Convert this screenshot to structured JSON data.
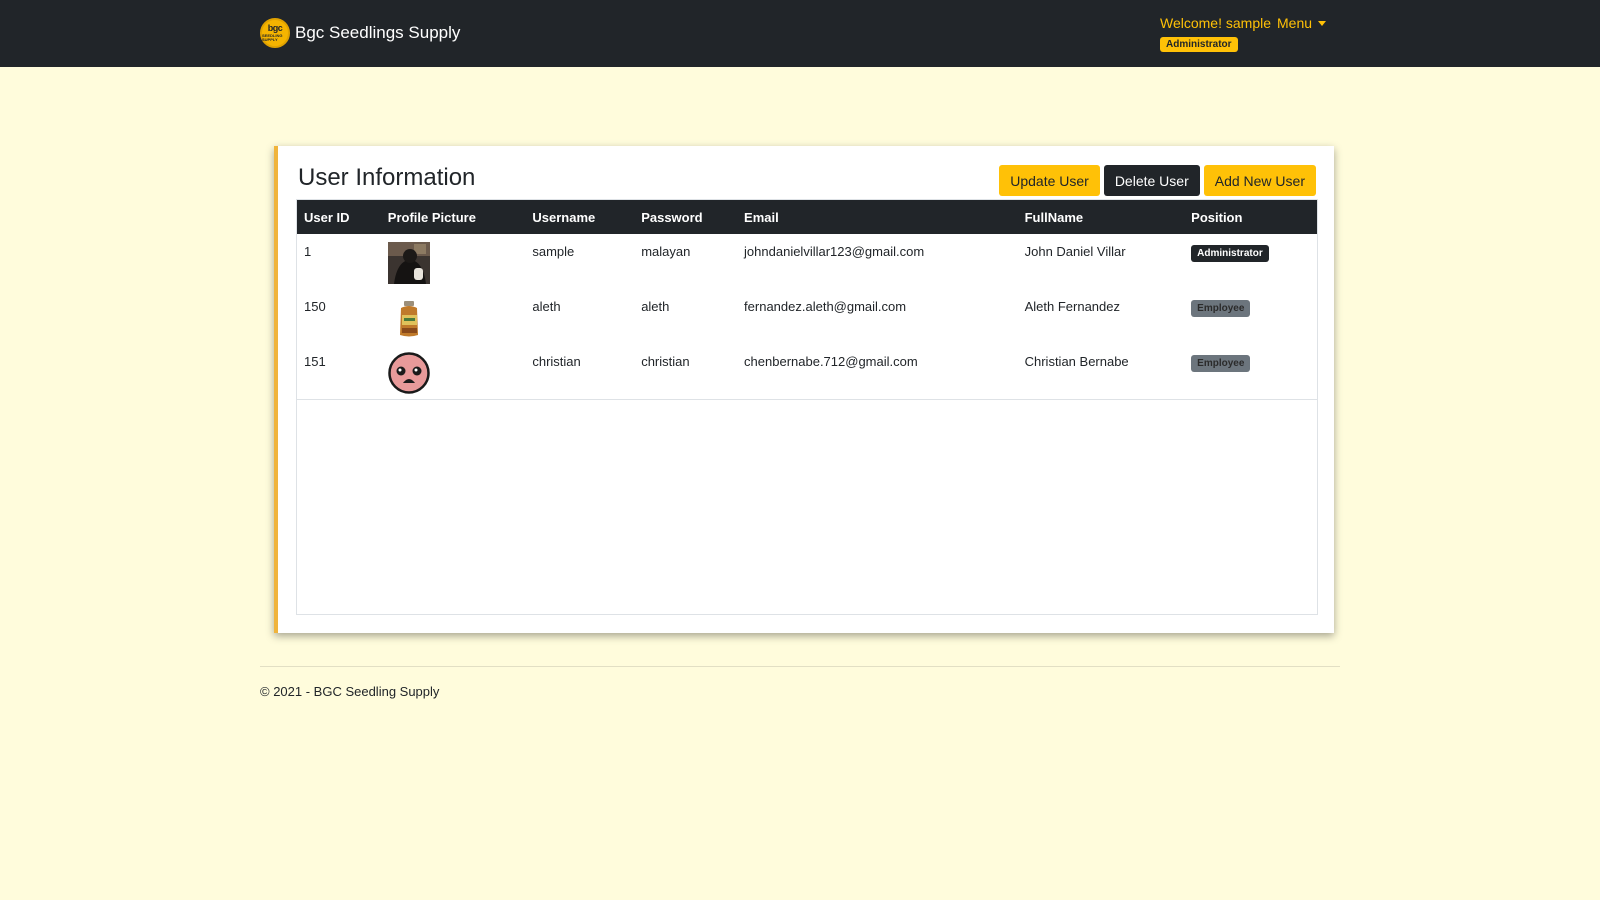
{
  "navbar": {
    "brand_logo_line1": "bgc",
    "brand_logo_line2": "SEEDLING SUPPLY",
    "brand_name": "Bgc Seedlings Supply",
    "welcome": "Welcome! sample",
    "menu_label": "Menu",
    "role_badge": "Administrator",
    "background": "#212529",
    "accent": "#ffc107"
  },
  "card": {
    "title": "User Information",
    "buttons": {
      "update": "Update User",
      "delete": "Delete User",
      "add": "Add New User"
    }
  },
  "table": {
    "headers": [
      "User ID",
      "Profile Picture",
      "Username",
      "Password",
      "Email",
      "FullName",
      "Position"
    ],
    "rows": [
      {
        "user_id": "1",
        "picture": "dark-photo",
        "username": "sample",
        "password": "malayan",
        "email": "johndanielvillar123@gmail.com",
        "fullname": "John Daniel Villar",
        "position": "Administrator"
      },
      {
        "user_id": "150",
        "picture": "jar-photo",
        "username": "aleth",
        "password": "aleth",
        "email": "fernandez.aleth@gmail.com",
        "fullname": "Aleth Fernandez",
        "position": "Employee"
      },
      {
        "user_id": "151",
        "picture": "cartoon-face",
        "username": "christian",
        "password": "christian",
        "email": "chenbernabe.712@gmail.com",
        "fullname": "Christian Bernabe",
        "position": "Employee"
      }
    ]
  },
  "footer": {
    "text": "© 2021 - BGC Seedling Supply"
  },
  "colors": {
    "page_background": "#fffcdc",
    "card_accent": "#f0b43c",
    "badge_admin": "#212529",
    "badge_employee": "#6c757d"
  }
}
